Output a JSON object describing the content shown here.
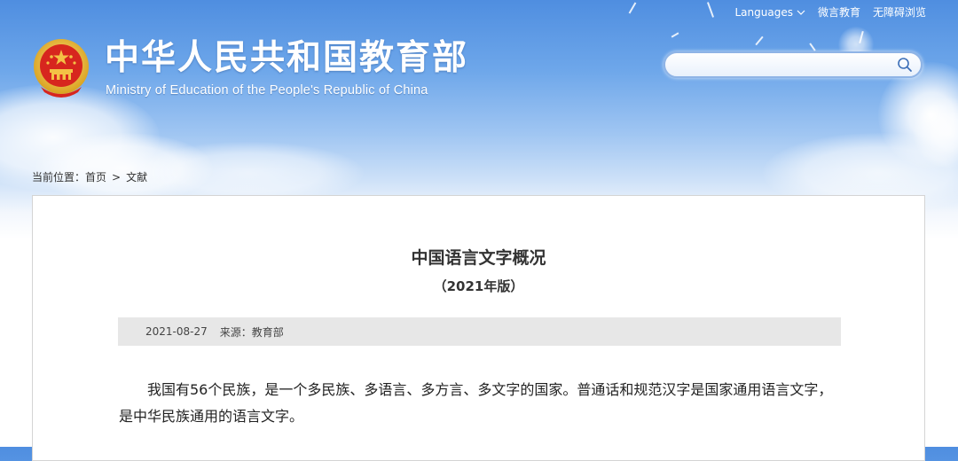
{
  "header": {
    "top_links": {
      "languages": "Languages",
      "weibo_education": "微言教育",
      "accessibility": "无障碍浏览"
    },
    "site_title_cn": "中华人民共和国教育部",
    "site_title_en": "Ministry of Education of the People's Republic of China",
    "search": {
      "value": "",
      "placeholder": ""
    }
  },
  "breadcrumb": {
    "label": "当前位置：",
    "items": [
      "首页",
      "文献"
    ],
    "separator": ">"
  },
  "article": {
    "title": "中国语言文字概况",
    "subtitle": "（2021年版）",
    "date": "2021-08-27",
    "source_label": "来源：教育部",
    "body": "我国有56个民族，是一个多民族、多语言、多方言、多文字的国家。普通话和规范汉字是国家通用语言文字，是中华民族通用的语言文字。"
  },
  "icons": {
    "emblem": "national-emblem-icon",
    "search": "search-icon",
    "languages_dropdown": "chevron-down-icon"
  },
  "colors": {
    "sky_top": "#4f8ee0",
    "emblem_red": "#d7261e",
    "emblem_gold": "#f4c245",
    "meta_bar": "#e7e7e7",
    "text": "#333333"
  }
}
